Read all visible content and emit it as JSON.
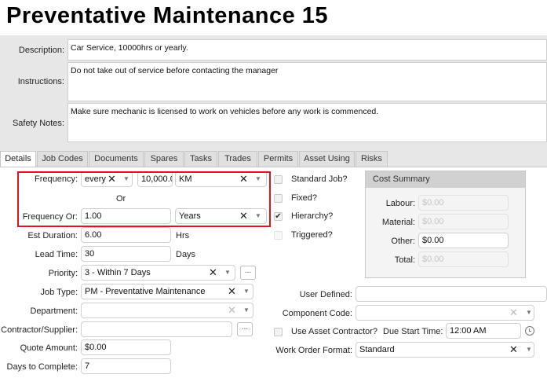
{
  "page_title": "Preventative Maintenance 15",
  "description": {
    "label": "Description:",
    "value": "Car Service, 10000hrs or yearly."
  },
  "instructions": {
    "label": "Instructions:",
    "value": "Do not take out of service before contacting the manager"
  },
  "safety_notes": {
    "label": "Safety Notes:",
    "value": "Make sure mechanic is licensed to work on vehicles before any work is commenced."
  },
  "tabs": [
    {
      "label": "Details",
      "active": true
    },
    {
      "label": "Job Codes"
    },
    {
      "label": "Documents"
    },
    {
      "label": "Spares"
    },
    {
      "label": "Tasks"
    },
    {
      "label": "Trades"
    },
    {
      "label": "Permits"
    },
    {
      "label": "Asset Using"
    },
    {
      "label": "Risks"
    }
  ],
  "frequency": {
    "label": "Frequency:",
    "mode": "every",
    "value": "10,000.0",
    "unit": "KM"
  },
  "or_label": "Or",
  "frequency_or": {
    "label": "Frequency Or:",
    "value": "1.00",
    "unit": "Years"
  },
  "est_duration": {
    "label": "Est Duration:",
    "value": "6.00",
    "unit": "Hrs"
  },
  "lead_time": {
    "label": "Lead Time:",
    "value": "30",
    "unit": "Days"
  },
  "priority": {
    "label": "Priority:",
    "value": "3 - Within 7 Days"
  },
  "job_type": {
    "label": "Job Type:",
    "value": "PM - Preventative Maintenance"
  },
  "department": {
    "label": "Department:",
    "value": ""
  },
  "contractor": {
    "label": "Contractor/Supplier:",
    "value": ""
  },
  "quote_amount": {
    "label": "Quote Amount:",
    "value": "$0.00"
  },
  "days_to_complete": {
    "label": "Days to Complete:",
    "value": "7"
  },
  "checkboxes": {
    "standard_job": {
      "label": "Standard Job?",
      "checked": false
    },
    "fixed": {
      "label": "Fixed?",
      "checked": false
    },
    "hierarchy": {
      "label": "Hierarchy?",
      "checked": true
    },
    "triggered": {
      "label": "Triggered?",
      "checked": false
    }
  },
  "cost_summary": {
    "title": "Cost Summary",
    "labour": {
      "label": "Labour:",
      "value": "$0.00"
    },
    "material": {
      "label": "Material:",
      "value": "$0.00"
    },
    "other": {
      "label": "Other:",
      "value": "$0.00"
    },
    "total": {
      "label": "Total:",
      "value": "$0.00"
    }
  },
  "user_defined": {
    "label": "User Defined:",
    "value": ""
  },
  "component_code": {
    "label": "Component Code:",
    "value": ""
  },
  "use_asset_contractor": {
    "label": "Use Asset Contractor?",
    "checked": false
  },
  "due_start_time": {
    "label": "Due Start Time:",
    "value": "12:00 AM"
  },
  "work_order_format": {
    "label": "Work Order Format:",
    "value": "Standard"
  },
  "glyphs": {
    "clear": "✕",
    "dropdown": "▼",
    "more": "...",
    "check": "✔"
  }
}
